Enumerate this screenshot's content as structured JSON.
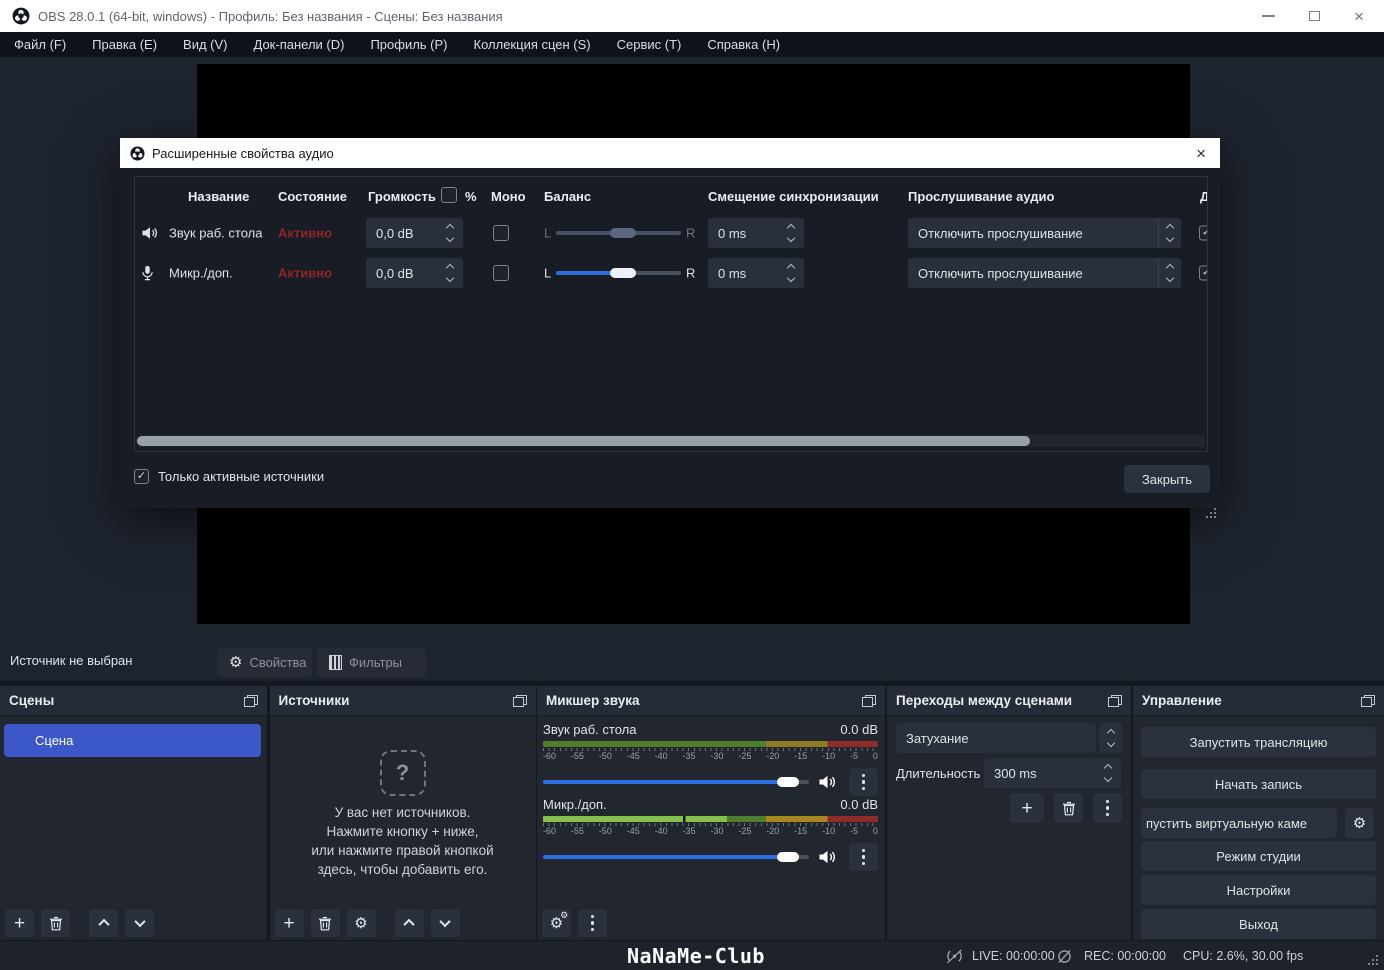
{
  "window": {
    "title": "OBS 28.0.1 (64-bit, windows) - Профиль: Без названия - Сцены: Без названия"
  },
  "menu": {
    "items": [
      "Файл (F)",
      "Правка (E)",
      "Вид (V)",
      "Док-панели (D)",
      "Профиль (P)",
      "Коллекция сцен (S)",
      "Сервис (T)",
      "Справка (H)"
    ]
  },
  "dialog": {
    "title": "Расширенные свойства аудио",
    "header": {
      "name": "Название",
      "status": "Состояние",
      "volume": "Громкость",
      "percent": "%",
      "mono": "Моно",
      "balance": "Баланс",
      "sync_offset": "Смещение синхронизации",
      "monitoring": "Прослушивание аудио",
      "tracks_clipped": "До"
    },
    "rows": [
      {
        "name": "Звук раб. стола",
        "status": "Активно",
        "volume": "0,0 dB",
        "balance_l": "L",
        "balance_r": "R",
        "sync": "0 ms",
        "monitoring": "Отключить прослушивание"
      },
      {
        "name": "Микр./доп.",
        "status": "Активно",
        "volume": "0,0 dB",
        "balance_l": "L",
        "balance_r": "R",
        "sync": "0 ms",
        "monitoring": "Отключить прослушивание"
      }
    ],
    "active_only": "Только активные источники",
    "close": "Закрыть"
  },
  "toolbar": {
    "no_source": "Источник не выбран",
    "properties": "Свойства",
    "filters": "Фильтры"
  },
  "panels": {
    "scenes": {
      "title": "Сцены",
      "items": [
        "Сцена"
      ]
    },
    "sources": {
      "title": "Источники",
      "empty_icon": "?",
      "empty_lines": [
        "У вас нет источников.",
        "Нажмите кнопку + ниже,",
        "или нажмите правой кнопкой",
        "здесь, чтобы добавить его."
      ]
    },
    "mixer": {
      "title": "Микшер звука",
      "scale": [
        "-60",
        "-55",
        "-50",
        "-45",
        "-40",
        "-35",
        "-30",
        "-25",
        "-20",
        "-15",
        "-10",
        "-5",
        "0"
      ],
      "channels": [
        {
          "name": "Звук раб. стола",
          "db": "0.0 dB"
        },
        {
          "name": "Микр./доп.",
          "db": "0.0 dB"
        }
      ]
    },
    "transitions": {
      "title": "Переходы между сценами",
      "transition": "Затухание",
      "duration_label": "Длительность",
      "duration_value": "300 ms"
    },
    "controls": {
      "title": "Управление",
      "start_stream": "Запустить трансляцию",
      "start_record": "Начать запись",
      "virtual_cam": "пустить виртуальную каме",
      "studio_mode": "Режим студии",
      "settings": "Настройки",
      "exit": "Выход"
    }
  },
  "statusbar": {
    "watermark": "NaNaMe-Club",
    "live": "LIVE: 00:00:00",
    "rec": "REC: 00:00:00",
    "cpu": "CPU: 2.6%, 30.00 fps"
  },
  "checkmark": "✓",
  "colors": {
    "scene_selected_blue": "#3c58c8",
    "slider_blue": "#2e6fe0",
    "active_red": "#8f2626",
    "meter_green": "#4e7e2e",
    "meter_green_bright": "#84c14a",
    "meter_yellow": "#8f7c22",
    "meter_red": "#8f2c28"
  }
}
